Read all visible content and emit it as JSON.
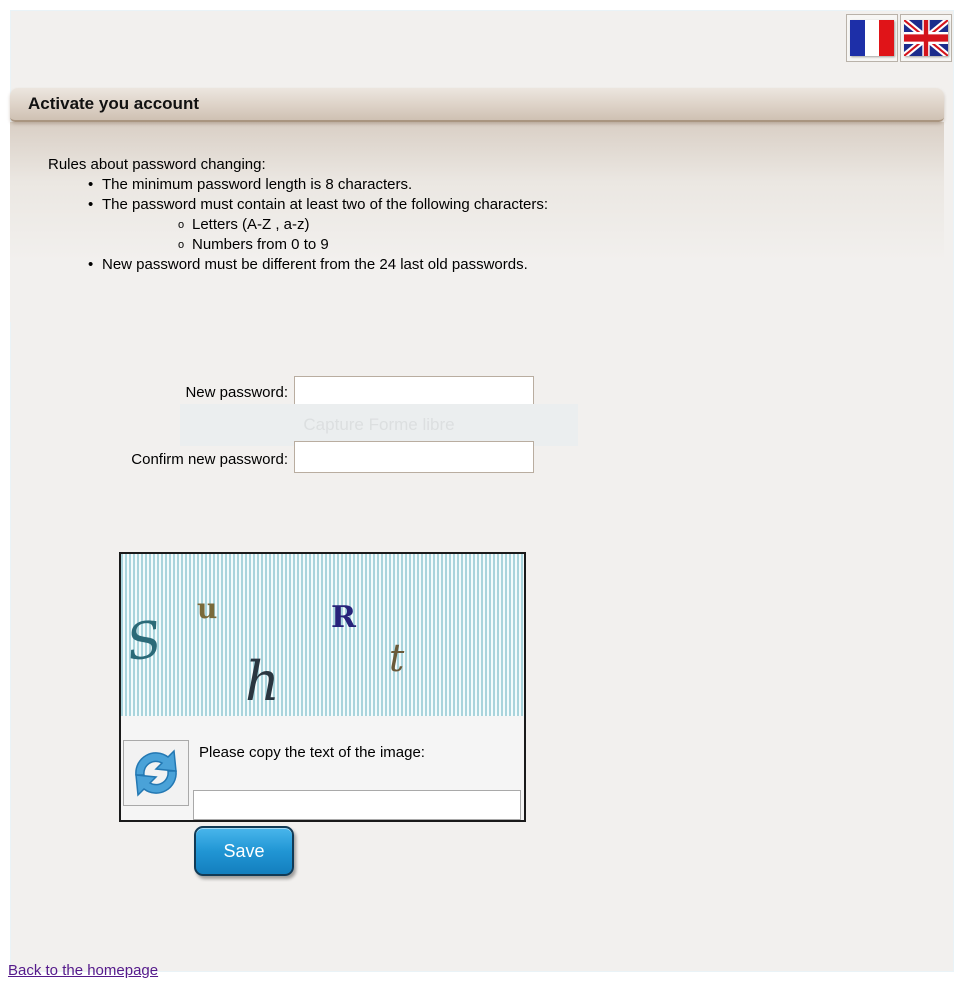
{
  "header": {
    "title": "Activate you account",
    "languages": [
      {
        "name": "French",
        "icon": "french-flag-icon"
      },
      {
        "name": "English",
        "icon": "uk-flag-icon"
      }
    ]
  },
  "rules": {
    "intro": "Rules about password changing:",
    "items": [
      "The minimum password length is 8 characters.",
      "The password must contain at least two of the following characters:",
      "New password must be different from the 24 last old passwords."
    ],
    "sub_items": [
      "Letters (A-Z , a-z)",
      "Numbers from 0 to 9"
    ]
  },
  "form": {
    "new_password_label": "New password:",
    "new_password_value": "",
    "confirm_password_label": "Confirm new password:",
    "confirm_password_value": "",
    "overlay_text": "Capture Forme libre"
  },
  "captcha": {
    "characters": [
      "S",
      "u",
      "h",
      "R",
      "t"
    ],
    "instruction": "Please copy the text of the image:",
    "input_value": "",
    "refresh_icon": "refresh-icon"
  },
  "actions": {
    "save_label": "Save",
    "back_link": "Back to the homepage"
  },
  "colors": {
    "accent_button": "#2196d4",
    "header_border": "#a99580",
    "link": "#551a8b"
  }
}
